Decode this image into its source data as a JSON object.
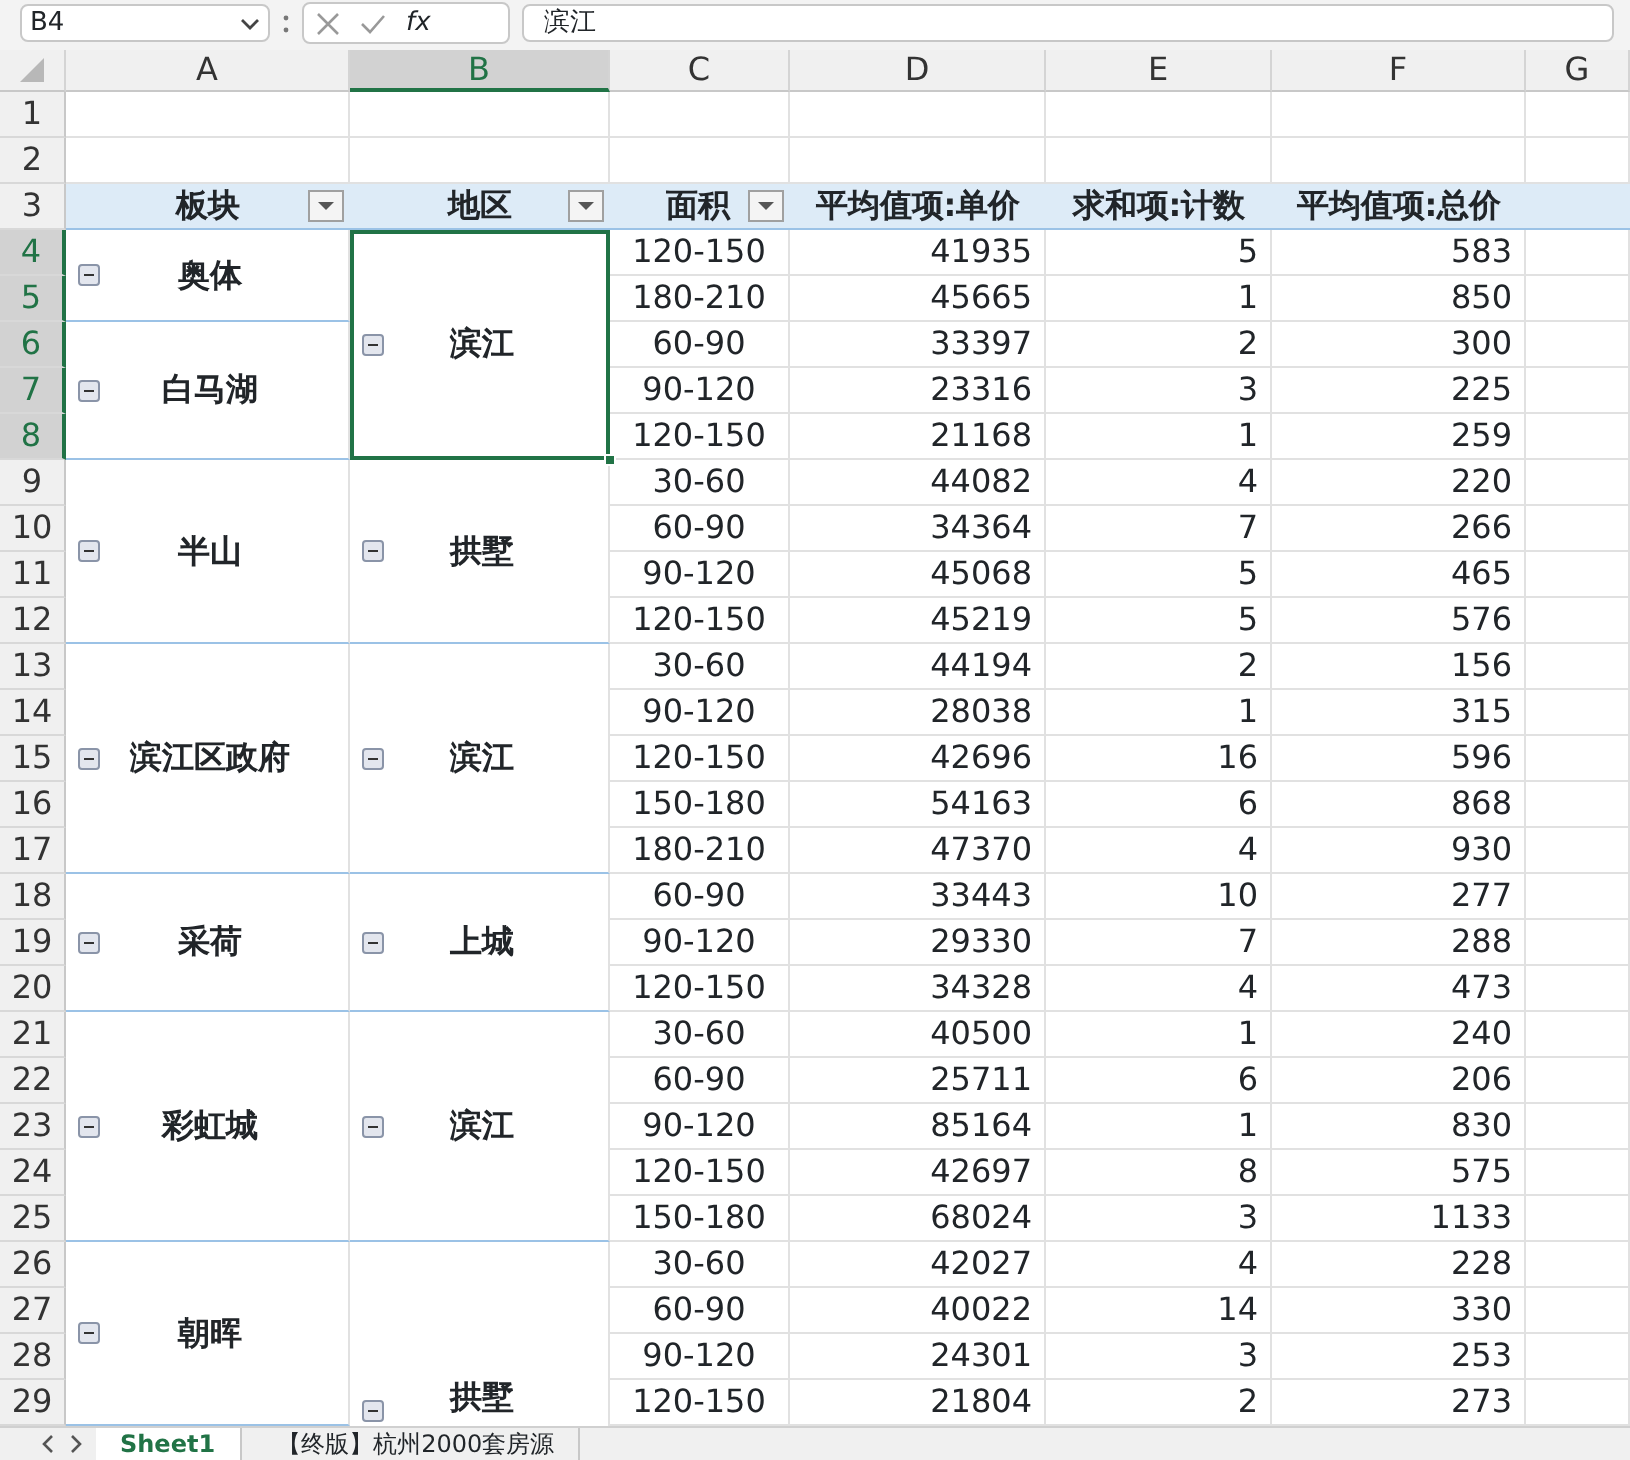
{
  "formula_bar": {
    "name_box": "B4",
    "function_label": "fx",
    "formula": "滨江"
  },
  "column_headers": [
    {
      "label": "A",
      "selected": false
    },
    {
      "label": "B",
      "selected": true
    },
    {
      "label": "C",
      "selected": false
    },
    {
      "label": "D",
      "selected": false
    },
    {
      "label": "E",
      "selected": false
    },
    {
      "label": "F",
      "selected": false
    },
    {
      "label": "G",
      "selected": false
    }
  ],
  "row_numbers": [
    {
      "label": "1",
      "selected": false
    },
    {
      "label": "2",
      "selected": false
    },
    {
      "label": "3",
      "selected": false
    },
    {
      "label": "4",
      "selected": true
    },
    {
      "label": "5",
      "selected": true
    },
    {
      "label": "6",
      "selected": true
    },
    {
      "label": "7",
      "selected": true
    },
    {
      "label": "8",
      "selected": true
    },
    {
      "label": "9",
      "selected": false
    },
    {
      "label": "10",
      "selected": false
    },
    {
      "label": "11",
      "selected": false
    },
    {
      "label": "12",
      "selected": false
    },
    {
      "label": "13",
      "selected": false
    },
    {
      "label": "14",
      "selected": false
    },
    {
      "label": "15",
      "selected": false
    },
    {
      "label": "16",
      "selected": false
    },
    {
      "label": "17",
      "selected": false
    },
    {
      "label": "18",
      "selected": false
    },
    {
      "label": "19",
      "selected": false
    },
    {
      "label": "20",
      "selected": false
    },
    {
      "label": "21",
      "selected": false
    },
    {
      "label": "22",
      "selected": false
    },
    {
      "label": "23",
      "selected": false
    },
    {
      "label": "24",
      "selected": false
    },
    {
      "label": "25",
      "selected": false
    },
    {
      "label": "26",
      "selected": false
    },
    {
      "label": "27",
      "selected": false
    },
    {
      "label": "28",
      "selected": false
    },
    {
      "label": "29",
      "selected": false
    }
  ],
  "pivot_headers": [
    {
      "label": "板块",
      "filter": true
    },
    {
      "label": "地区",
      "filter": true
    },
    {
      "label": "面积",
      "filter": true
    },
    {
      "label": "平均值项:单价",
      "filter": false
    },
    {
      "label": "求和项:计数",
      "filter": false
    },
    {
      "label": "平均值项:总价",
      "filter": false
    }
  ],
  "districts": [
    {
      "name": "滨江",
      "selected": true,
      "plates": [
        {
          "name": "奥体",
          "rows": [
            [
              "120-150",
              "41935",
              "5",
              "583"
            ],
            [
              "180-210",
              "45665",
              "1",
              "850"
            ]
          ]
        },
        {
          "name": "白马湖",
          "rows": [
            [
              "60-90",
              "33397",
              "2",
              "300"
            ],
            [
              "90-120",
              "23316",
              "3",
              "225"
            ],
            [
              "120-150",
              "21168",
              "1",
              "259"
            ]
          ]
        }
      ]
    },
    {
      "name": "拱墅",
      "selected": false,
      "plates": [
        {
          "name": "半山",
          "rows": [
            [
              "30-60",
              "44082",
              "4",
              "220"
            ],
            [
              "60-90",
              "34364",
              "7",
              "266"
            ],
            [
              "90-120",
              "45068",
              "5",
              "465"
            ],
            [
              "120-150",
              "45219",
              "5",
              "576"
            ]
          ]
        }
      ]
    },
    {
      "name": "滨江",
      "selected": false,
      "plates": [
        {
          "name": "滨江区政府",
          "rows": [
            [
              "30-60",
              "44194",
              "2",
              "156"
            ],
            [
              "90-120",
              "28038",
              "1",
              "315"
            ],
            [
              "120-150",
              "42696",
              "16",
              "596"
            ],
            [
              "150-180",
              "54163",
              "6",
              "868"
            ],
            [
              "180-210",
              "47370",
              "4",
              "930"
            ]
          ]
        }
      ]
    },
    {
      "name": "上城",
      "selected": false,
      "plates": [
        {
          "name": "采荷",
          "rows": [
            [
              "60-90",
              "33443",
              "10",
              "277"
            ],
            [
              "90-120",
              "29330",
              "7",
              "288"
            ],
            [
              "120-150",
              "34328",
              "4",
              "473"
            ]
          ]
        }
      ]
    },
    {
      "name": "滨江",
      "selected": false,
      "plates": [
        {
          "name": "彩虹城",
          "rows": [
            [
              "30-60",
              "40500",
              "1",
              "240"
            ],
            [
              "60-90",
              "25711",
              "6",
              "206"
            ],
            [
              "90-120",
              "85164",
              "1",
              "830"
            ],
            [
              "120-150",
              "42697",
              "8",
              "575"
            ],
            [
              "150-180",
              "68024",
              "3",
              "1133"
            ]
          ]
        }
      ]
    },
    {
      "name": "拱墅",
      "selected": false,
      "plates": [
        {
          "name": "朝晖",
          "rows": [
            [
              "30-60",
              "42027",
              "4",
              "228"
            ],
            [
              "60-90",
              "40022",
              "14",
              "330"
            ],
            [
              "90-120",
              "24301",
              "3",
              "253"
            ],
            [
              "120-150",
              "21804",
              "2",
              "273"
            ]
          ]
        }
      ]
    }
  ],
  "sheet_tabs": [
    {
      "label": "Sheet1",
      "selected": true
    },
    {
      "label": "【终版】杭州2000套房源",
      "selected": false
    }
  ]
}
